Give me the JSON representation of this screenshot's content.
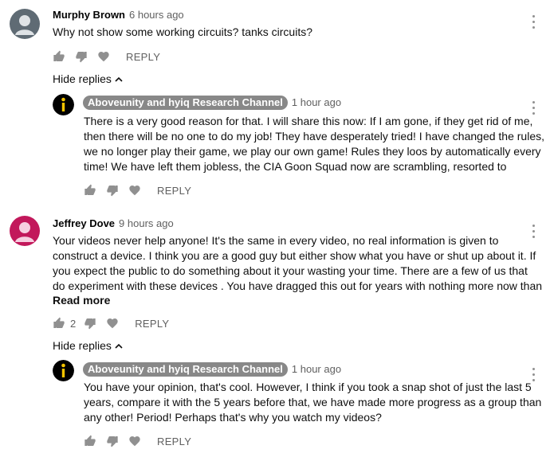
{
  "comments": [
    {
      "author": "Murphy Brown",
      "time": "6 hours ago",
      "text": "Why not show some working circuits? tanks circuits?",
      "reply_label": "REPLY",
      "hide_replies": "Hide replies",
      "avatar_color": "#5f6b74",
      "reply": {
        "author": "Aboveunity and hyiq Research Channel",
        "time": "1 hour ago",
        "lines": [
          "There is a very good reason for that. I will share this now: If I am gone, if they get rid of me,",
          "then there will be no one to do my job! They have desperately tried! I have changed the rules,",
          "we no longer play their game, we play our own game! Rules they loos by automatically every",
          "time! We have left them jobless, the CIA Goon Squad now are scrambling, resorted to"
        ],
        "reply_label": "REPLY"
      }
    },
    {
      "author": "Jeffrey Dove",
      "time": "9 hours ago",
      "lines": [
        "Your videos never help anyone!  It's the same in every video,  no real information is given to",
        "construct a device.  I think you are a good guy but either show what you have or shut up about it.  If",
        "you expect the public to do something about it your wasting your time.  There are a few of us that",
        "do experiment with these devices . You have dragged this out for years with nothing more now than"
      ],
      "read_more": "Read more",
      "like_count": "2",
      "reply_label": "REPLY",
      "hide_replies": "Hide replies",
      "avatar_color": "#c2185b",
      "reply": {
        "author": "Aboveunity and hyiq Research Channel",
        "time": "1 hour ago",
        "lines": [
          "You have your opinion, that's cool. However, I think if you took a snap shot of just the last 5",
          "years, compare it with the 5 years before that, we have made more progress as a group than",
          "any other! Period! Perhaps that's why you watch my videos?"
        ],
        "reply_label": "REPLY"
      }
    }
  ],
  "colors": {
    "text": "#0f0f0f",
    "secondary": "#606060",
    "icon": "#909090",
    "chip": "#888888"
  }
}
